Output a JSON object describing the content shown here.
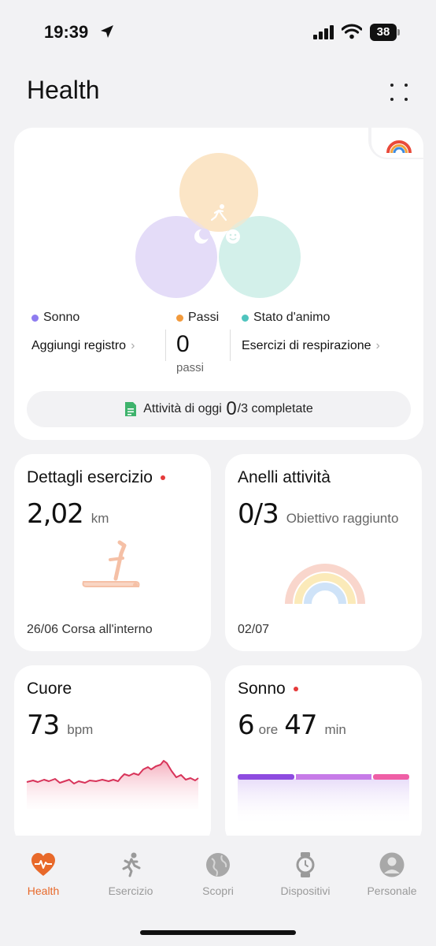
{
  "status_bar": {
    "time": "19:39",
    "battery": "38"
  },
  "header": {
    "title": "Health"
  },
  "hero": {
    "columns": [
      {
        "label": "Sonno",
        "color": "#8e7cf0",
        "link": "Aggiungi registro"
      },
      {
        "label": "Passi",
        "color": "#f29a3c",
        "value": "0",
        "unit": "passi"
      },
      {
        "label": "Stato d'animo",
        "color": "#4fc4be",
        "link": "Esercizi di respirazione"
      }
    ],
    "today": {
      "prefix": "Attività di oggi",
      "done": "0",
      "suffix": "/3 completate"
    }
  },
  "cards": {
    "exercise": {
      "title": "Dettagli esercizio",
      "value": "2,02",
      "unit": "km",
      "footer": "26/06 Corsa all'interno"
    },
    "rings": {
      "title": "Anelli attività",
      "value": "0/3",
      "unit": "Obiettivo raggiunto",
      "footer": "02/07"
    },
    "heart": {
      "title": "Cuore",
      "value": "73",
      "unit": "bpm"
    },
    "sleep": {
      "title": "Sonno",
      "hours": "6",
      "hours_unit": "ore",
      "minutes": "47",
      "minutes_unit": "min"
    }
  },
  "nav": {
    "items": [
      {
        "label": "Health",
        "icon": "heart-icon",
        "active": true
      },
      {
        "label": "Esercizio",
        "icon": "runner-icon"
      },
      {
        "label": "Scopri",
        "icon": "globe-icon"
      },
      {
        "label": "Dispositivi",
        "icon": "watch-icon"
      },
      {
        "label": "Personale",
        "icon": "person-icon"
      }
    ]
  },
  "colors": {
    "accent": "#e8692a",
    "heart_line": "#d8345a",
    "sleep_deep": "#8e4be0",
    "sleep_light": "#c77be8",
    "sleep_rem": "#ef5fa6"
  }
}
